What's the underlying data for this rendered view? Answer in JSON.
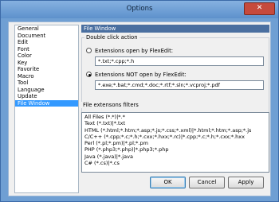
{
  "window": {
    "title": "Options",
    "close_glyph": "✕"
  },
  "nav": {
    "items": [
      "General",
      "Document",
      "Edit",
      "Font",
      "Color",
      "Key",
      "Favorite",
      "Macro",
      "Tool",
      "Language",
      "Update",
      "File Window"
    ],
    "selected_index": 11
  },
  "panel": {
    "header": "File Window",
    "double_click": {
      "group_label": "Double click action",
      "option_open_label": "Extensions open by FlexEdit:",
      "option_open_value": "*.txt;*.cpp;*.h",
      "option_not_open_label": "Extensions NOT open by FlexEdit:",
      "option_not_open_value": "*.exe;*.bat;*.cmd;*.doc;*.rtf;*.sln;*.vcproj;*.pdf",
      "selected": "not_open"
    },
    "filters": {
      "group_label": "File extensons filters",
      "lines": [
        "All Files (*.*)|*.*",
        "Text (*.txt)|*.txt",
        "HTML (*.html;*.htm;*.asp;*.js;*.css;*.xml)|*.html;*.htm;*.asp;*.js",
        "C/C++ (*.cpp;*.c;*.h;*.cxx;*.hxx;*.rc)|*.cpp;*.c;*.h;*.cxx;*.hxx",
        "Perl (*.pl;*.pm)|*.pl;*.pm",
        "PHP (*.php3;*.php)|*.php3;*.php",
        "Java (*.java)|*.java",
        "C# (*.cs)|*.cs"
      ]
    }
  },
  "buttons": {
    "ok": "OK",
    "cancel": "Cancel",
    "apply": "Apply"
  }
}
